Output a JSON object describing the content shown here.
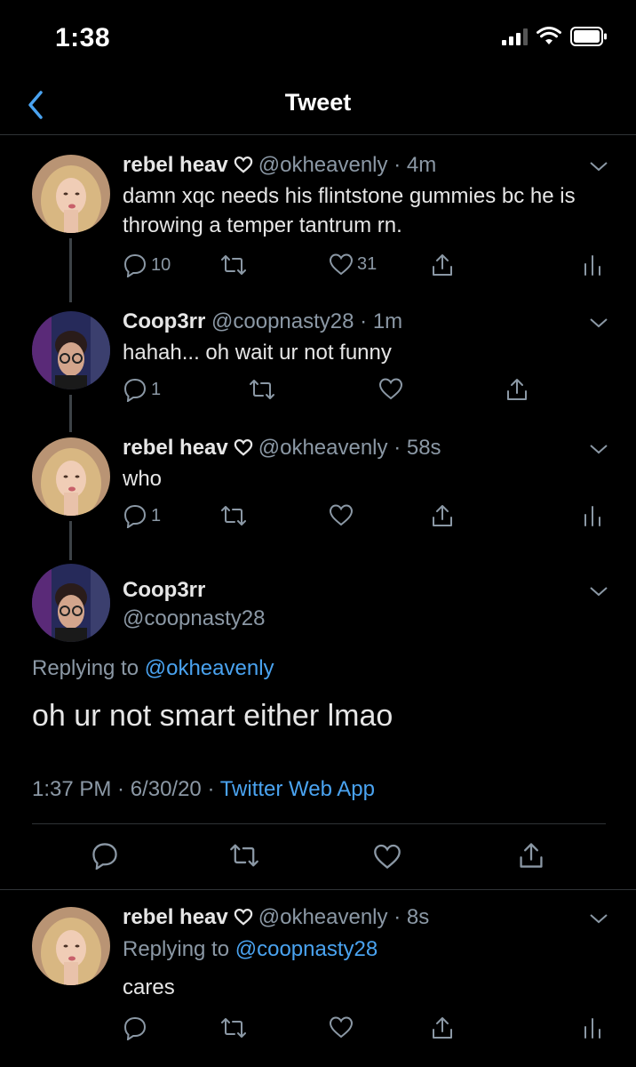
{
  "status_bar": {
    "time": "1:38"
  },
  "nav": {
    "title": "Tweet"
  },
  "tweets": [
    {
      "name": "rebel heav",
      "handle": "@okheavenly",
      "time": "· 4m",
      "text": "damn xqc needs his flintstone gummies bc he is throwing a temper tantrum rn.",
      "reply_count": "10",
      "like_count": "31"
    },
    {
      "name": "Coop3rr",
      "handle": "@coopnasty28",
      "time": "· 1m",
      "text": "hahah... oh wait ur not funny",
      "reply_count": "1"
    },
    {
      "name": "rebel heav",
      "handle": "@okheavenly",
      "time": "· 58s",
      "text": "who",
      "reply_count": "1"
    }
  ],
  "main_tweet": {
    "name": "Coop3rr",
    "handle": "@coopnasty28",
    "replying_prefix": "Replying to",
    "replying_handle": "@okheavenly",
    "text": "oh ur not smart either lmao",
    "timestamp": "1:37 PM · 6/30/20 · ",
    "source": "Twitter Web App"
  },
  "reply": {
    "name": "rebel heav",
    "handle": "@okheavenly",
    "time": "· 8s",
    "replying_prefix": "Replying to",
    "replying_handle": "@coopnasty28",
    "text": "cares"
  },
  "colors": {
    "accent": "#4aa3f0",
    "background": "#000000",
    "muted": "#8b98a5"
  },
  "icons": [
    "back-chevron-icon",
    "reply-icon",
    "retweet-icon",
    "like-icon",
    "share-icon",
    "analytics-icon",
    "caret-down-icon"
  ]
}
